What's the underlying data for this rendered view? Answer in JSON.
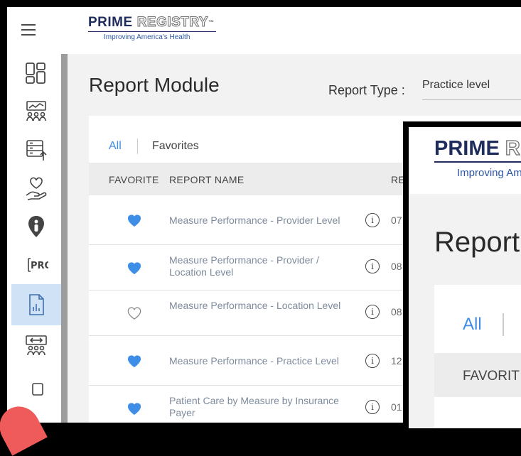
{
  "header": {
    "logo_main": "PRIME",
    "logo_outline": "REGISTRY",
    "logo_tm": "™",
    "tagline": "Improving America's Health"
  },
  "sidebar": {
    "items": [
      {
        "icon": "dashboard-icon"
      },
      {
        "icon": "population-icon"
      },
      {
        "icon": "data-upload-icon"
      },
      {
        "icon": "care-hand-heart-icon"
      },
      {
        "icon": "location-pin-icon"
      },
      {
        "icon": "pro-icon",
        "label": "PRO"
      },
      {
        "icon": "reports-icon",
        "active": true
      },
      {
        "icon": "team-icon"
      },
      {
        "icon": "device-icon"
      }
    ]
  },
  "main": {
    "title": "Report Module",
    "report_type_label": "Report Type :",
    "report_type_value": "Practice level",
    "tabs": {
      "all": "All",
      "favorites": "Favorites"
    },
    "table": {
      "headers": [
        "FAVORITE",
        "REPORT NAME",
        "RE"
      ],
      "rows": [
        {
          "favorite": true,
          "name": "Measure Performance - Provider Level",
          "date": "07"
        },
        {
          "favorite": true,
          "name": "Measure Performance - Provider / Location Level",
          "date": "08"
        },
        {
          "favorite": false,
          "name": "Measure Performance - Location Level",
          "date": "08"
        },
        {
          "favorite": true,
          "name": "Measure Performance - Practice Level",
          "date": "12"
        },
        {
          "favorite": true,
          "name": "Patient Care by Measure by Insurance Payer",
          "date": "01"
        }
      ]
    }
  },
  "overlay": {
    "logo_main": "PRIME",
    "logo_outline": "R",
    "tagline": "Improving Am",
    "title": "Report",
    "tab_all": "All",
    "header_favorite": "FAVORIT"
  },
  "colors": {
    "accent": "#3e8ee8",
    "heart": "#3e8ee8",
    "active_sidebar": "#cfe2f6",
    "brand_navy": "#1f2d5c"
  }
}
